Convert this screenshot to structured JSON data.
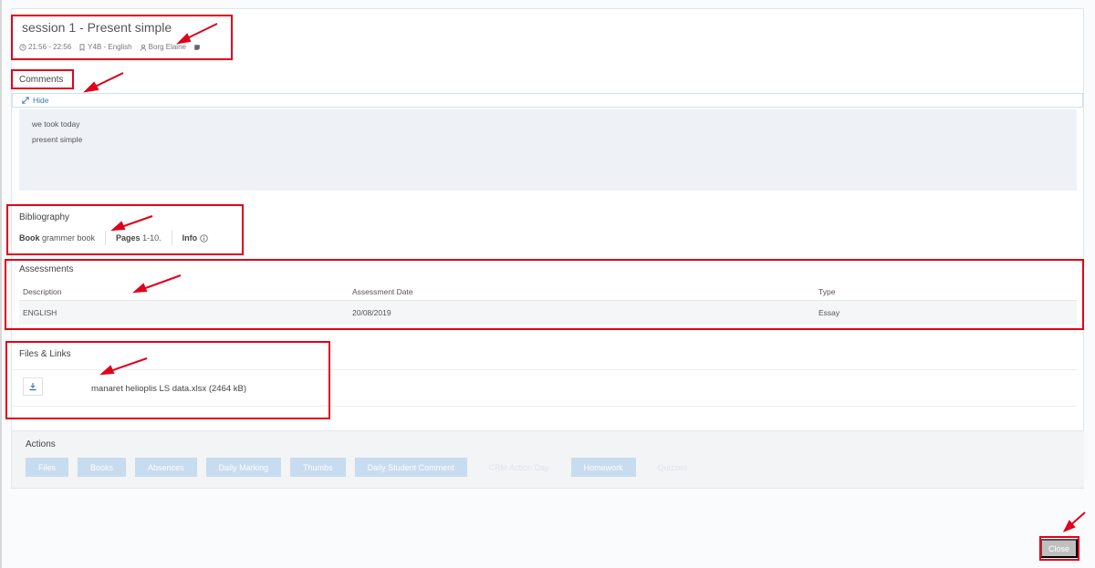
{
  "session": {
    "title": "session 1 - Present simple",
    "time": "21:56 - 22:56",
    "class": "Y4B - English",
    "teacher": "Borg Elaine"
  },
  "comments": {
    "label": "Comments",
    "toggle_label": "Hide",
    "lines": [
      "we took today",
      "present simple"
    ]
  },
  "bibliography": {
    "label": "Bibliography",
    "book_label": "Book",
    "book_value": "grammer book",
    "pages_label": "Pages",
    "pages_value": "1-10.",
    "info_label": "Info"
  },
  "assessments": {
    "label": "Assessments",
    "columns": [
      "Description",
      "Assessment Date",
      "Type"
    ],
    "rows": [
      [
        "ENGLISH",
        "20/08/2019",
        "Essay"
      ]
    ]
  },
  "files": {
    "label": "Files & Links",
    "items": [
      {
        "name": "manaret helioplis LS data.xlsx (2464 kB)"
      }
    ]
  },
  "actions": {
    "label": "Actions",
    "buttons": [
      "Files",
      "Books",
      "Absences",
      "Daily Marking",
      "Thumbs",
      "Daily Student Comment",
      "CRM Action Day",
      "Homework",
      "Quizzes"
    ]
  },
  "footer": {
    "close_label": "Close"
  },
  "colors": {
    "highlight": "#e0001b",
    "accent": "#3a77b5",
    "button": "#c7dcef"
  }
}
